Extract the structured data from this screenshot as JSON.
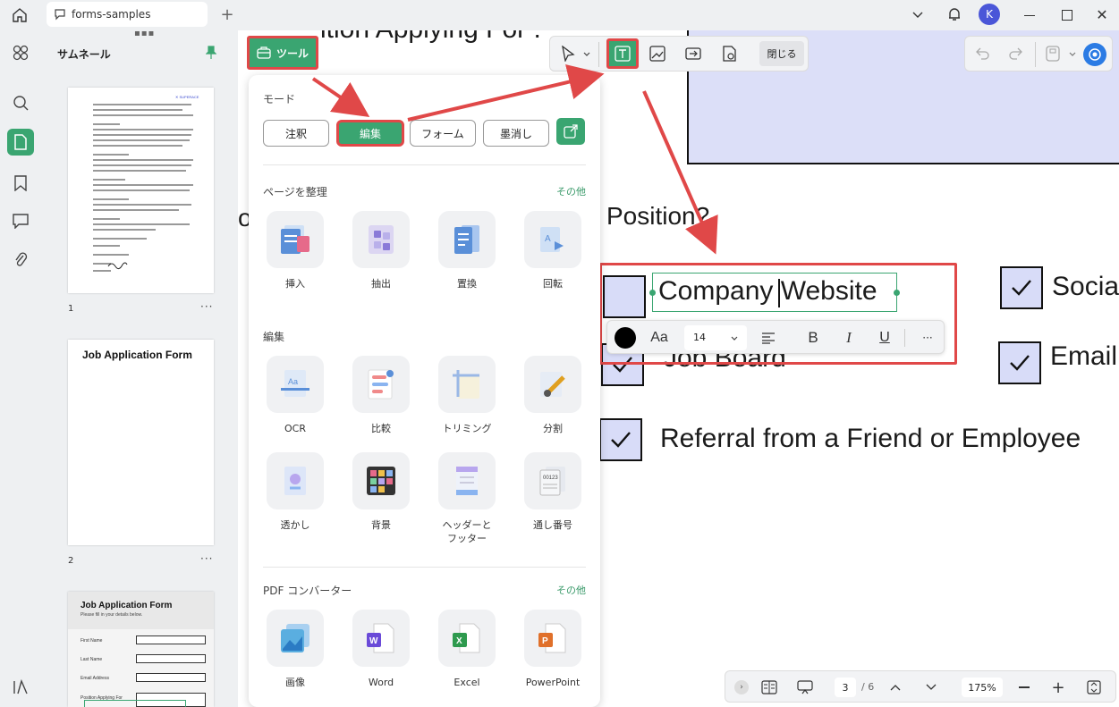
{
  "window": {
    "tab_title": "forms-samples"
  },
  "sidebar": {
    "title": "サムネール",
    "pages": [
      {
        "num": "1"
      },
      {
        "num": "2"
      }
    ],
    "page3_title": "Job Application Form",
    "page3_subtitle": "Please fill in your details below.",
    "page3_fields": [
      "First Name",
      "Last Name",
      "Email Address",
      "Position Applying For"
    ]
  },
  "thumb2": {
    "title": "Job Application Form"
  },
  "tools_button": {
    "label": "ツール"
  },
  "panel": {
    "mode_title": "モード",
    "modes": [
      "注釈",
      "編集",
      "フォーム",
      "墨消し"
    ],
    "organize_title": "ページを整理",
    "more_label": "その他",
    "organize_items": [
      "挿入",
      "抽出",
      "置換",
      "回転"
    ],
    "edit_title": "編集",
    "edit_items": [
      "OCR",
      "比較",
      "トリミング",
      "分割",
      "透かし",
      "背景",
      "ヘッダーと\nフッター",
      "通し番号"
    ],
    "converter_title": "PDF コンバーター",
    "converter_items": [
      "画像",
      "Word",
      "Excel",
      "PowerPoint"
    ]
  },
  "edit_toolbar": {
    "close_label": "閉じる"
  },
  "document": {
    "heading_partial": "ition Applying For :",
    "question": "Position?",
    "options": [
      "Company Website",
      "Job Board",
      "Referral from a Friend or Employee",
      "Socia",
      "Email"
    ],
    "left_char": "o"
  },
  "text_format": {
    "size": "14",
    "font_icon": "Aa"
  },
  "bottom_bar": {
    "page_current": "3",
    "page_total": "/ 6",
    "zoom": "175%"
  },
  "user": {
    "avatar_letter": "K"
  },
  "colors": {
    "accent": "#3aa571",
    "highlight": "#e04848",
    "checkbox_fill": "#d8dcf8"
  }
}
